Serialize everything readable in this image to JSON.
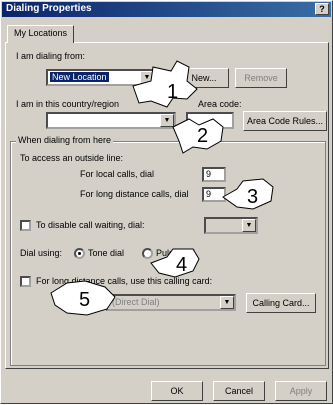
{
  "window": {
    "title": "Dialing Properties",
    "help": "?"
  },
  "tab": {
    "label": "My Locations"
  },
  "location": {
    "dialing_from_label": "I am dialing from:",
    "dialing_from_value": "New Location",
    "new_button": "New...",
    "remove_button": "Remove",
    "country_label": "I am in this country/region",
    "area_code_label": "Area code:",
    "area_code_rules_button": "Area Code Rules..."
  },
  "dialing_group": {
    "label": "When dialing from here",
    "outside_line_label": "To access an outside line:",
    "local_label": "For local calls, dial",
    "local_value": "9",
    "long_distance_label": "For long distance calls, dial",
    "long_distance_value": "9",
    "call_waiting_label": "To disable call waiting, dial:",
    "dial_using_label": "Dial using:",
    "tone_label": "Tone dial",
    "pulse_label": "Pulse dial",
    "calling_card_label": "For long distance calls, use this calling card:",
    "calling_card_value": "(Direct Dial)",
    "calling_card_button": "Calling Card..."
  },
  "footer": {
    "ok": "OK",
    "cancel": "Cancel",
    "apply": "Apply"
  },
  "callouts": [
    "1",
    "2",
    "3",
    "4",
    "5"
  ]
}
